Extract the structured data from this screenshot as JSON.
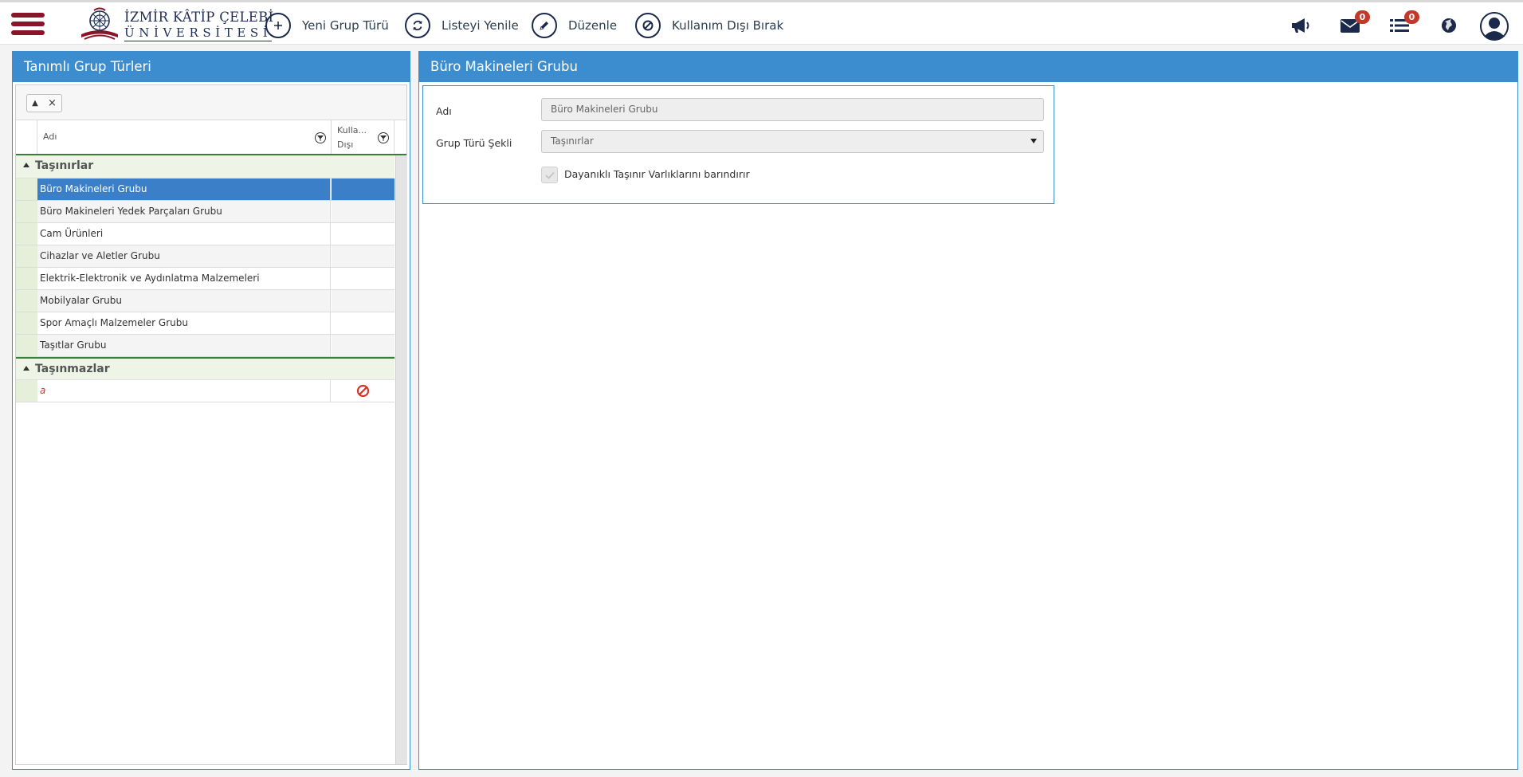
{
  "header": {
    "logo": {
      "line1": "İZMİR KÂTİP ÇELEBİ",
      "line2": "ÜNİVERSİTESİ"
    },
    "toolbar": {
      "new_group_type": "Yeni Grup Türü",
      "refresh_list": "Listeyi Yenile",
      "edit": "Düzenle",
      "deactivate": "Kullanım Dışı Bırak"
    },
    "messages_badge": "0",
    "tasks_badge": "0"
  },
  "left_panel": {
    "title": "Tanımlı Grup Türleri",
    "columns": {
      "name": "Adı",
      "inactive_line1": "Kulla...",
      "inactive_line2": "Dışı"
    },
    "groups": [
      {
        "label": "Taşınırlar",
        "rows": [
          {
            "name": "Büro Makineleri Grubu",
            "selected": true
          },
          {
            "name": "Büro Makineleri Yedek Parçaları Grubu"
          },
          {
            "name": "Cam Ürünleri"
          },
          {
            "name": "Cihazlar ve Aletler Grubu"
          },
          {
            "name": "Elektrik-Elektronik ve Aydınlatma Malzemeleri"
          },
          {
            "name": "Mobilyalar Grubu"
          },
          {
            "name": "Spor Amaçlı Malzemeler Grubu"
          },
          {
            "name": "Taşıtlar Grubu"
          }
        ]
      },
      {
        "label": "Taşınmazlar",
        "rows": [
          {
            "name": "a",
            "inactive": true
          }
        ]
      }
    ]
  },
  "right_panel": {
    "title": "Büro Makineleri Grubu",
    "form": {
      "name_label": "Adı",
      "name_value": "Büro Makineleri Grubu",
      "type_label": "Grup Türü Şekli",
      "type_value": "Taşınırlar",
      "checkbox_label": "Dayanıklı Taşınır Varlıklarını barındırır",
      "checkbox_checked": true
    }
  },
  "colors": {
    "panel_header": "#3c8dcf",
    "selected_row": "#3a7fc8",
    "brand": "#8a1528",
    "badge": "#c0392b",
    "inactive_icon": "#d8352a"
  }
}
